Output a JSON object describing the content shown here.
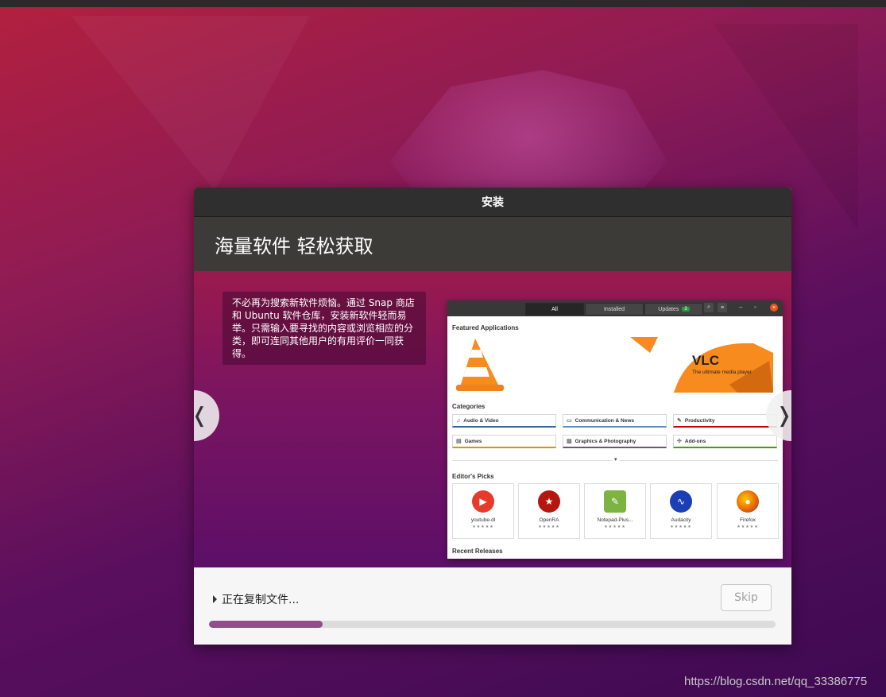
{
  "window": {
    "title": "安装",
    "header": "海量软件 轻松获取"
  },
  "slide": {
    "text": "不必再为搜索新软件烦恼。通过 Snap 商店和 Ubuntu 软件仓库，安装新软件轻而易举。只需输入要寻找的内容或浏览相应的分类，即可连同其他用户的有用评价一同获得。",
    "prev_icon": "❬",
    "next_icon": "❭"
  },
  "store": {
    "tabs": [
      "All",
      "Installed",
      "Updates"
    ],
    "updates_badge": "3",
    "featured_title": "Featured Applications",
    "banner_title": "VLC",
    "banner_subtitle": "The ultimate media player",
    "categories_title": "Categories",
    "categories": [
      {
        "label": "Audio & Video",
        "icon": "music-icon",
        "color": "#3465a4"
      },
      {
        "label": "Communication & News",
        "icon": "chat-icon",
        "color": "#5d8fcf"
      },
      {
        "label": "Productivity",
        "icon": "doc-icon",
        "color": "#cc0000"
      },
      {
        "label": "Games",
        "icon": "game-icon",
        "color": "#c4a000"
      },
      {
        "label": "Graphics & Photography",
        "icon": "image-icon",
        "color": "#75507b"
      },
      {
        "label": "Add-ons",
        "icon": "addon-icon",
        "color": "#4e9a06"
      }
    ],
    "editors_title": "Editor's Picks",
    "picks": [
      {
        "name": "youtube-dl",
        "color": "#e53b2c",
        "stars": "★★★★★"
      },
      {
        "name": "OpenRA",
        "color": "#b5170e",
        "stars": "★★★★★"
      },
      {
        "name": "Notepad-Plus...",
        "color": "#7cb342",
        "stars": "★★★★★"
      },
      {
        "name": "Audacity",
        "color": "#1a3fb5",
        "stars": "★★★★★"
      },
      {
        "name": "Firefox",
        "color": "#e66000",
        "stars": "★★★★★"
      }
    ],
    "recent_title": "Recent Releases"
  },
  "footer": {
    "status": "正在复制文件...",
    "skip_label": "Skip",
    "progress": 0.2
  },
  "watermark": "https://blog.csdn.net/qq_33386775"
}
